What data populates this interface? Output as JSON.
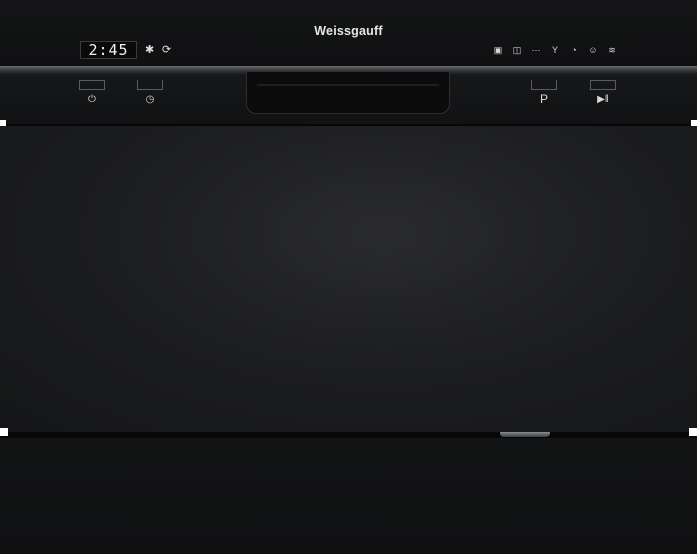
{
  "brand": "Weissgauff",
  "display": {
    "time": "2:45"
  },
  "display_icons": {
    "snowflake": "✱",
    "cycle": "⟳"
  },
  "indicators": [
    "▣",
    "◫",
    "⋯",
    "Y",
    "◔",
    "☺",
    "≋"
  ],
  "controls": {
    "power": "⏻",
    "delay": "◷",
    "program": "P",
    "start": "▶‖"
  },
  "colors": {
    "body": "#141516",
    "trim": "#6b6d70",
    "text": "#e6e6e6"
  }
}
